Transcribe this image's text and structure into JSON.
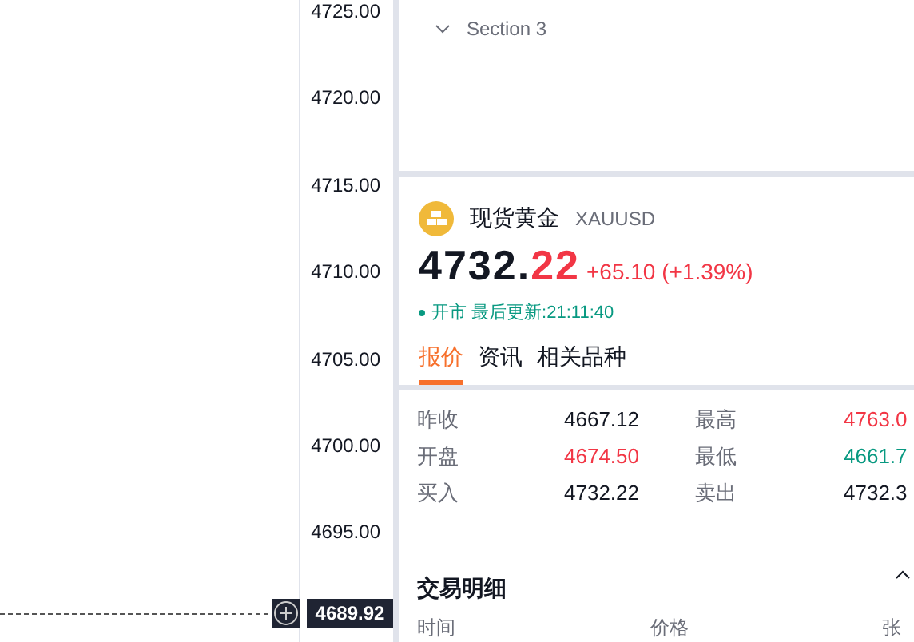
{
  "price_axis": {
    "labels": [
      "4725.00",
      "4720.00",
      "4715.00",
      "4710.00",
      "4705.00",
      "4700.00",
      "4695.00"
    ],
    "crosshair_price": "4689.92"
  },
  "section": {
    "title": "Section 3",
    "expanded": false
  },
  "quote": {
    "name": "现货黄金",
    "symbol": "XAUUSD",
    "price_integer": "4732.",
    "price_decimals": "22",
    "change": "+65.10 (+1.39%)",
    "color": "#f23645",
    "market_open": true,
    "status": "开市 最后更新:21:11:40"
  },
  "tabs": [
    {
      "label": "报价",
      "selected": true
    },
    {
      "label": "资讯",
      "selected": false
    },
    {
      "label": "相关品种",
      "selected": false
    }
  ],
  "stats": [
    {
      "label": "昨收",
      "value": "4667.12",
      "color": "#131722"
    },
    {
      "label": "最高",
      "value": "4763.0",
      "color": "#f23645"
    },
    {
      "label": "开盘",
      "value": "4674.50",
      "color": "#f23645"
    },
    {
      "label": "最低",
      "value": "4661.7",
      "color": "#089981"
    },
    {
      "label": "买入",
      "value": "4732.22",
      "color": "#131722"
    },
    {
      "label": "卖出",
      "value": "4732.3",
      "color": "#131722"
    }
  ],
  "trades": {
    "title": "交易明细",
    "expanded": true,
    "columns": [
      "时间",
      "价格",
      "张"
    ]
  }
}
